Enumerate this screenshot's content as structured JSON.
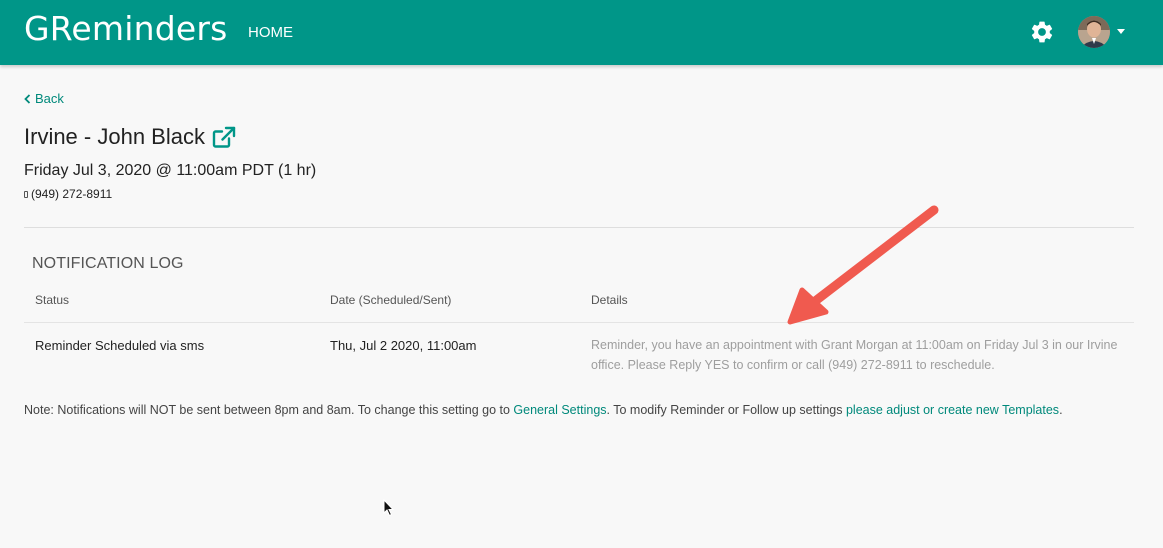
{
  "navbar": {
    "brand": "GReminders",
    "home_label": "HOME",
    "color": "#009688"
  },
  "page": {
    "back_label": "Back",
    "title": "Irvine - John Black",
    "datetime": "Friday Jul 3, 2020 @ 11:00am PDT (1 hr)",
    "phone": "(949) 272-8911"
  },
  "log": {
    "heading": "NOTIFICATION LOG",
    "columns": [
      "Status",
      "Date (Scheduled/Sent)",
      "Details"
    ],
    "rows": [
      {
        "status": "Reminder Scheduled via sms",
        "date": "Thu, Jul 2 2020, 11:00am",
        "details": "Reminder, you have an appointment with Grant Morgan at 11:00am on Friday Jul 3 in our Irvine office. Please Reply YES to confirm or call (949) 272-8911 to reschedule."
      }
    ]
  },
  "note": {
    "prefix": "Note: Notifications will NOT be sent between 8pm and 8am. To change this setting go to ",
    "link1": "General Settings",
    "middle": ". To modify Reminder or Follow up settings ",
    "link2": "please adjust or create new Templates",
    "suffix": "."
  },
  "colors": {
    "accent": "#009688",
    "link": "#00897b",
    "annotation_arrow": "#f05a4f"
  }
}
